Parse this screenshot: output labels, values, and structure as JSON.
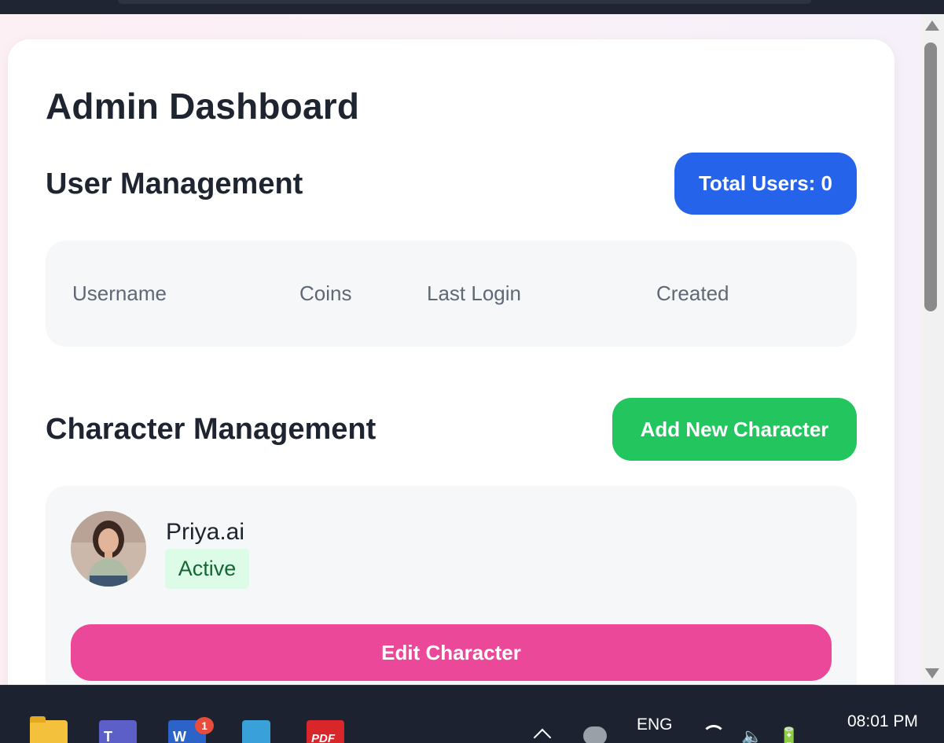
{
  "page": {
    "title": "Admin Dashboard"
  },
  "user_management": {
    "title": "User Management",
    "total_users_label": "Total Users: 0",
    "columns": [
      "Username",
      "Coins",
      "Last Login",
      "Created"
    ]
  },
  "character_management": {
    "title": "Character Management",
    "add_button_label": "Add New Character",
    "characters": [
      {
        "name": "Priya.ai",
        "status": "Active",
        "edit_label": "Edit Character"
      }
    ]
  },
  "taskbar": {
    "apps": [
      "file-explorer-icon",
      "teams-icon",
      "word-icon",
      "notepad-icon",
      "pdf-icon"
    ],
    "word_notifications": "1",
    "word_letter": "W",
    "teams_letter": "T",
    "pdf_letter": "PDF",
    "language": "ENG",
    "time": "08:01 PM"
  },
  "colors": {
    "total_users_button": "#2563eb",
    "add_character_button": "#22c55e",
    "edit_character_button": "#ec4899",
    "active_badge_bg": "#dcfce7",
    "active_badge_text": "#166534"
  }
}
